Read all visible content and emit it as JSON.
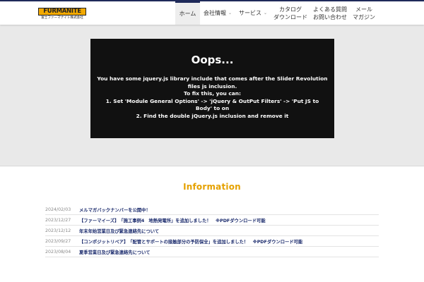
{
  "header": {
    "logo_main": "FURMANITE",
    "logo_sub": "富士ファーマナイト株式会社",
    "nav": {
      "home": "ホーム",
      "company": "会社情報",
      "service": "サービス",
      "catalog": [
        "カタログ",
        "ダウンロード"
      ],
      "faq": [
        "よくある質問",
        "お問い合わせ"
      ],
      "mail": [
        "メール",
        "マガジン"
      ]
    }
  },
  "error": {
    "title": "Oops...",
    "lines": [
      "You have some jquery.js library include that comes after the Slider Revolution",
      "files js inclusion.",
      "To fix this, you can:",
      "1. Set 'Module General Options' -> 'jQuery & OutPut Filters' -> 'Put JS to",
      "Body' to on",
      "2. Find the double jQuery.js inclusion and remove it"
    ]
  },
  "information": {
    "title": "Information",
    "items": [
      {
        "date": "2024/02/03",
        "text": "メルマガバックナンバーを公開中！"
      },
      {
        "date": "2023/12/27",
        "text": "【ファーマイーズ】　「施工事例4　地熱発電所」を追加しました！　※PDFダウンロード可能"
      },
      {
        "date": "2023/12/12",
        "text": "年末年始営業日及び緊急連絡先について"
      },
      {
        "date": "2023/09/27",
        "text": "【コンポジットリペア】　「配管とサポートの接触部分の予防保全」を追加しました！　※PDFダウンロード可能"
      },
      {
        "date": "2023/08/04",
        "text": "夏季営業日及び緊急連絡先について"
      }
    ]
  }
}
